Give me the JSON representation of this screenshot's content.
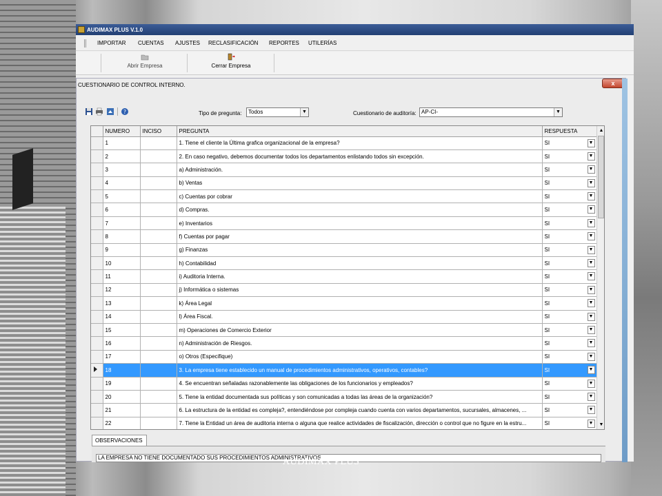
{
  "window": {
    "title": "AUDIMAX PLUS V.1.0"
  },
  "menu": [
    "IMPORTAR",
    "CUENTAS",
    "AJUSTES",
    "RECLASIFICACIÓN",
    "REPORTES",
    "UTILERÍAS"
  ],
  "toolbar": {
    "open_label": "Abrir Empresa",
    "close_label": "Cerrar Empresa"
  },
  "form": {
    "title": "CUESTIONARIO DE CONTROL INTERNO.",
    "close_symbol": "x",
    "tipo_label": "Tipo de pregunta:",
    "tipo_value": "Todos",
    "cuestionario_label": "Cuestionario de auditoría:",
    "cuestionario_value": "AP-CI-"
  },
  "grid": {
    "columns": [
      "NUMERO",
      "INCISO",
      "PREGUNTA",
      "RESPUESTA"
    ],
    "selected_row": 17,
    "rows": [
      {
        "numero": "1",
        "inciso": "",
        "pregunta": "1.      Tiene el cliente la Última grafica organizacional de la empresa?",
        "respuesta": "SI"
      },
      {
        "numero": "2",
        "inciso": "",
        "pregunta": "2.      En caso negativo, debemos documentar todos los departamentos enlistando todos sin excepción.",
        "respuesta": "SI"
      },
      {
        "numero": "3",
        "inciso": "",
        "pregunta": "a)     Administración.",
        "respuesta": "SI"
      },
      {
        "numero": "4",
        "inciso": "",
        "pregunta": "b)     Ventas",
        "respuesta": "SI"
      },
      {
        "numero": "5",
        "inciso": "",
        "pregunta": "c)     Cuentas por cobrar",
        "respuesta": "SI"
      },
      {
        "numero": "6",
        "inciso": "",
        "pregunta": "d)     Compras.",
        "respuesta": "SI"
      },
      {
        "numero": "7",
        "inciso": "",
        "pregunta": "e)     Inventarios",
        "respuesta": "SI"
      },
      {
        "numero": "8",
        "inciso": "",
        "pregunta": "f)      Cuentas por pagar",
        "respuesta": "SI"
      },
      {
        "numero": "9",
        "inciso": "",
        "pregunta": "g)     Finanzas",
        "respuesta": "SI"
      },
      {
        "numero": "10",
        "inciso": "",
        "pregunta": "h)     Contabilidad",
        "respuesta": "SI"
      },
      {
        "numero": "11",
        "inciso": "",
        "pregunta": "i)       Auditoria Interna.",
        "respuesta": "SI"
      },
      {
        "numero": "12",
        "inciso": "",
        "pregunta": "j)       Informática o sistemas",
        "respuesta": "SI"
      },
      {
        "numero": "13",
        "inciso": "",
        "pregunta": "k)     Área Legal",
        "respuesta": "SI"
      },
      {
        "numero": "14",
        "inciso": "",
        "pregunta": "l)       Área Fiscal.",
        "respuesta": "SI"
      },
      {
        "numero": "15",
        "inciso": "",
        "pregunta": "m)   Operaciones de Comercio Exterior",
        "respuesta": "SI"
      },
      {
        "numero": "16",
        "inciso": "",
        "pregunta": "n)     Administración de Riesgos.",
        "respuesta": "SI"
      },
      {
        "numero": "17",
        "inciso": "",
        "pregunta": "o)     Otros (Especifique)",
        "respuesta": "SI"
      },
      {
        "numero": "18",
        "inciso": "",
        "pregunta": "3.      La empresa tiene establecido un manual de procedimientos administrativos, operativos, contables?",
        "respuesta": "SI"
      },
      {
        "numero": "19",
        "inciso": "",
        "pregunta": "4.      Se encuentran señaladas razonablemente las obligaciones de los funcionarios y empleados?",
        "respuesta": "SI"
      },
      {
        "numero": "20",
        "inciso": "",
        "pregunta": "5.      Tiene la entidad documentada sus políticas y son comunicadas a todas las áreas de la organización?",
        "respuesta": "SI"
      },
      {
        "numero": "21",
        "inciso": "",
        "pregunta": "6.      La estructura de la entidad es compleja?, entendiéndose por compleja cuando cuenta con varios departamentos, sucursales, almacenes, ...",
        "respuesta": "SI"
      },
      {
        "numero": "22",
        "inciso": "",
        "pregunta": "7.      Tiene la Entidad un área de auditoria interna o alguna que realice actividades de fiscalización, dirección o control que no figure en la estru...",
        "respuesta": "SI"
      }
    ]
  },
  "observaciones": {
    "tab_label": "OBSERVACIONES",
    "value": "LA EMPRESA NO TIENE DOCUMENTADO SUS PROCEDIMIENTOS ADMINISTRATIVOS"
  },
  "caption": "AUDIMAX PLUS",
  "icons": [
    "save-icon",
    "print-icon",
    "export-icon",
    "help-icon",
    "open-folder-icon",
    "exit-door-icon"
  ]
}
